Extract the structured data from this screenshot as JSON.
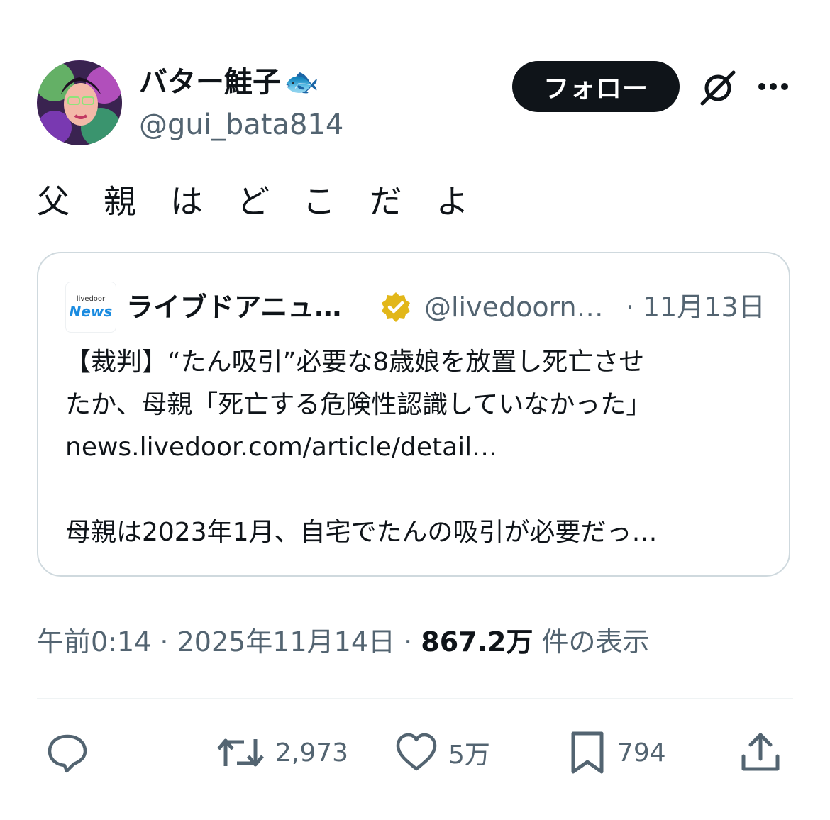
{
  "author": {
    "display_name": "バター鮭子",
    "name_emoji": "🐟",
    "handle": "@gui_bata814",
    "follow_label": "フォロー"
  },
  "tweet": {
    "text": "父親はどこだよ"
  },
  "quote": {
    "logo_small": "livedoor",
    "logo_big": "News",
    "name": "ライブドアニュ…",
    "handle": "@livedoorn…",
    "separator": "·",
    "date": "11月13日",
    "lines": [
      "【裁判】“たん吸引”必要な8歳娘を放置し死亡させ",
      "たか、母親「死亡する危険性認識していなかった」",
      "news.livedoor.com/article/detail…",
      "母親は2023年1月、自宅でたんの吸引が必要だっ…"
    ]
  },
  "meta": {
    "time": "午前0:14",
    "separator": " · ",
    "date": "2025年11月14日",
    "views_count": "867.2万",
    "views_label": " 件の表示"
  },
  "actions": {
    "retweets": "2,973",
    "likes": "5万",
    "bookmarks": "794"
  },
  "colors": {
    "text": "#0f1419",
    "secondary": "#536471",
    "border": "#cfd9de",
    "badge": "#e2b719",
    "link_logo": "#1a8be0"
  },
  "icons": [
    "grok-icon",
    "more-icon",
    "verified-badge-icon",
    "reply-icon",
    "retweet-icon",
    "like-icon",
    "bookmark-icon",
    "share-icon"
  ]
}
